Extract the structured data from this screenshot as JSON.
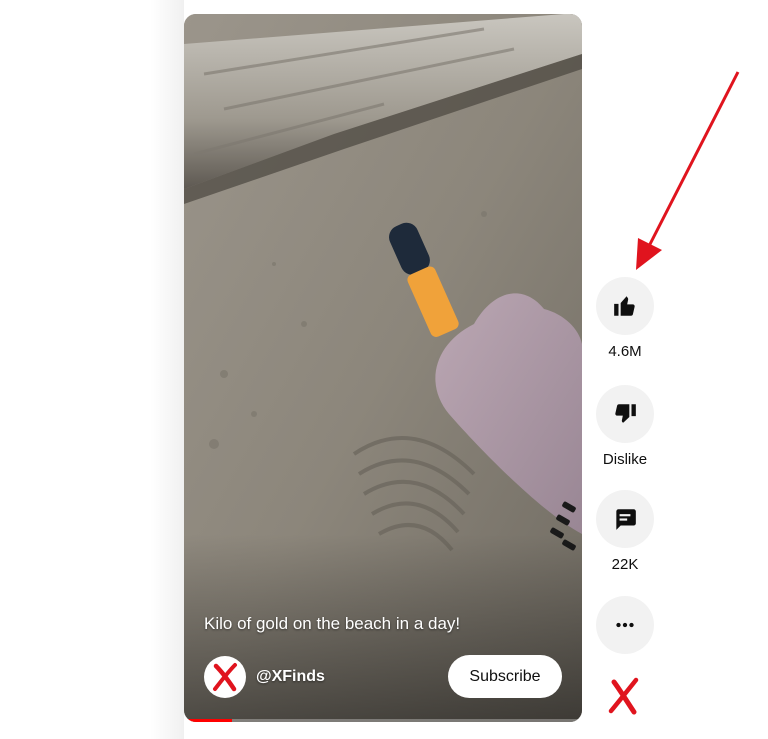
{
  "video": {
    "caption": "Kilo of gold on the beach in a day!",
    "channel_handle": "@XFinds",
    "subscribe_label": "Subscribe",
    "progress": 0.12
  },
  "actions": {
    "like": {
      "icon": "thumbs-up-icon",
      "count": "4.6M"
    },
    "dislike": {
      "icon": "thumbs-down-icon",
      "label": "Dislike"
    },
    "comments": {
      "icon": "comment-icon",
      "count": "22K"
    },
    "more": {
      "icon": "more-icon"
    }
  },
  "colors": {
    "accent": "#ff0000",
    "logo_red": "#e0141e",
    "button_bg": "#f2f2f2"
  }
}
